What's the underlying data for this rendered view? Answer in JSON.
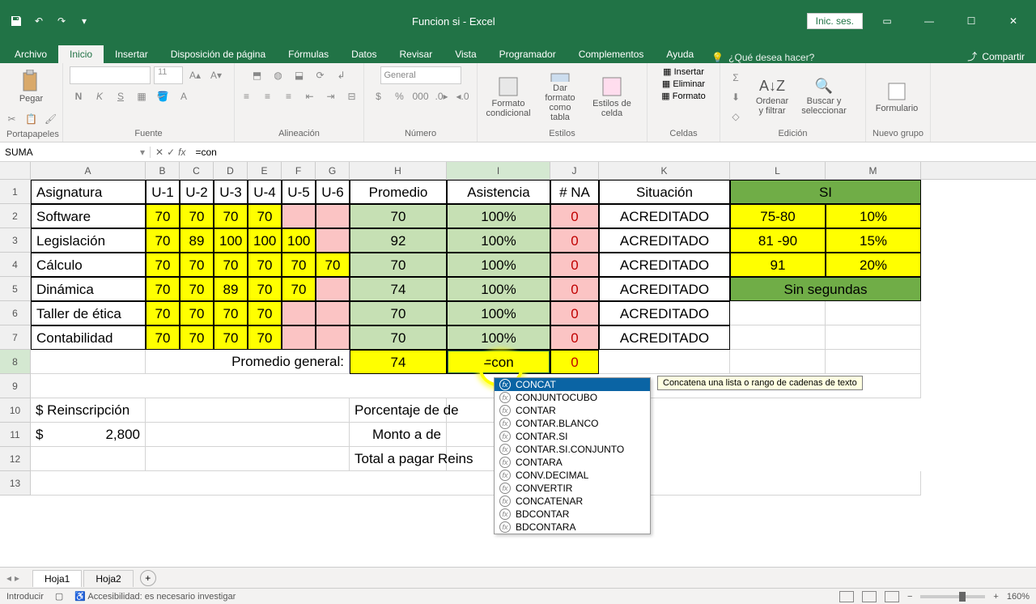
{
  "title": "Funcion si - Excel",
  "signin": "Inic. ses.",
  "share": "Compartir",
  "tabs": [
    "Archivo",
    "Inicio",
    "Insertar",
    "Disposición de página",
    "Fórmulas",
    "Datos",
    "Revisar",
    "Vista",
    "Programador",
    "Complementos",
    "Ayuda"
  ],
  "tellme": "¿Qué desea hacer?",
  "groups": {
    "clipboard": "Portapapeles",
    "paste": "Pegar",
    "font": "Fuente",
    "align": "Alineación",
    "number": "Número",
    "general": "General",
    "styles": "Estilos",
    "cond": "Formato condicional",
    "table": "Dar formato como tabla",
    "cellst": "Estilos de celda",
    "cells": "Celdas",
    "insert": "Insertar",
    "delete": "Eliminar",
    "format": "Formato",
    "editing": "Edición",
    "sort": "Ordenar y filtrar",
    "find": "Buscar y seleccionar",
    "newgroup": "Nuevo grupo",
    "form": "Formulario"
  },
  "namebox": "SUMA",
  "formula": "=con",
  "colHeaders": [
    "A",
    "B",
    "C",
    "D",
    "E",
    "F",
    "G",
    "H",
    "I",
    "J",
    "K",
    "L",
    "M"
  ],
  "headerRow": {
    "A": "Asignatura",
    "B": "U-1",
    "C": "U-2",
    "D": "U-3",
    "E": "U-4",
    "F": "U-5",
    "G": "U-6",
    "H": "Promedio",
    "I": "Asistencia",
    "J": "# NA",
    "K": "Situación",
    "L": "SI",
    "M": ""
  },
  "rows": [
    {
      "A": "Software",
      "u": [
        "70",
        "70",
        "70",
        "70",
        "",
        ""
      ],
      "H": "70",
      "I": "100%",
      "J": "0",
      "K": "ACREDITADO",
      "L": "75-80",
      "M": "10%"
    },
    {
      "A": "Legislación",
      "u": [
        "70",
        "89",
        "100",
        "100",
        "100",
        ""
      ],
      "H": "92",
      "I": "100%",
      "J": "0",
      "K": "ACREDITADO",
      "L": "81 -90",
      "M": "15%"
    },
    {
      "A": "Cálculo",
      "u": [
        "70",
        "70",
        "70",
        "70",
        "70",
        "70"
      ],
      "H": "70",
      "I": "100%",
      "J": "0",
      "K": "ACREDITADO",
      "L": "91",
      "M": "20%"
    },
    {
      "A": "Dinámica",
      "u": [
        "70",
        "70",
        "89",
        "70",
        "70",
        ""
      ],
      "H": "74",
      "I": "100%",
      "J": "0",
      "K": "ACREDITADO",
      "L": "Sin segundas",
      "M": ""
    },
    {
      "A": "Taller de ética",
      "u": [
        "70",
        "70",
        "70",
        "70",
        "",
        ""
      ],
      "H": "70",
      "I": "100%",
      "J": "0",
      "K": "ACREDITADO",
      "L": "",
      "M": ""
    },
    {
      "A": "Contabilidad",
      "u": [
        "70",
        "70",
        "70",
        "70",
        "",
        ""
      ],
      "H": "70",
      "I": "100%",
      "J": "0",
      "K": "ACREDITADO",
      "L": "",
      "M": ""
    }
  ],
  "summary": {
    "label": "Promedio general:",
    "H": "74",
    "I": "=con",
    "J": "0"
  },
  "reinsc": {
    "label": "$ Reinscripción",
    "amount": "2,800",
    "dollar": "$"
  },
  "bottom": {
    "l1": "Porcentaje de de",
    "l2": "Monto a de",
    "l3": "Total a pagar Reins"
  },
  "autocomplete": {
    "items": [
      "CONCAT",
      "CONJUNTOCUBO",
      "CONTAR",
      "CONTAR.BLANCO",
      "CONTAR.SI",
      "CONTAR.SI.CONJUNTO",
      "CONTARA",
      "CONV.DECIMAL",
      "CONVERTIR",
      "CONCATENAR",
      "BDCONTAR",
      "BDCONTARA"
    ],
    "tooltip": "Concatena una lista o rango de cadenas de texto"
  },
  "sheets": [
    "Hoja1",
    "Hoja2"
  ],
  "status": {
    "mode": "Introducir",
    "access": "Accesibilidad: es necesario investigar",
    "zoom": "160%"
  }
}
